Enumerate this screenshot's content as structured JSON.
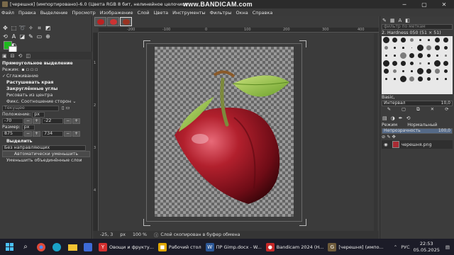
{
  "window": {
    "title": "[черешня] (импортировано)-6.0 (Цвета RGB 8 бит, нелинейное целочисленное, GIMP built-in s",
    "watermark": "www.BANDICAM.com"
  },
  "menu": [
    "Файл",
    "Правка",
    "Выделение",
    "Просмотр",
    "Изображение",
    "Слой",
    "Цвета",
    "Инструменты",
    "Фильтры",
    "Окна",
    "Справка"
  ],
  "tool_options": {
    "title": "Прямоугольное выделение",
    "mode_label": "Режим:",
    "antialias": "Сглаживание",
    "feather": "Растушевать края",
    "rounded": "Закруглённые углы",
    "from_center": "Рисовать из центра",
    "fixed_label": "Фикс. Соотношение сторон",
    "fixed_value": "Текущее",
    "position_label": "Положение:",
    "position_unit": "px",
    "pos_x": "-70",
    "pos_y": "-22",
    "size_label": "Размер:",
    "size_unit": "px",
    "size_w": "875",
    "size_h": "734",
    "highlight": "Выделить",
    "guides": "Без направляющих",
    "auto_shrink": "Автоматически уменьшить",
    "shrink_merged": "Уменьшить объединённые слои"
  },
  "status": {
    "coords": "-25, 3",
    "unit": "px",
    "zoom": "100 %",
    "message": "Слой скопирован в буфер обмена"
  },
  "brushes": {
    "filter_placeholder": "фильтр по меткам",
    "current": "2. Hardness 050 (51 × 51)",
    "preset": "Basic,",
    "spacing_label": "Интервал",
    "spacing_value": "10,0"
  },
  "layers": {
    "mode_label": "Режим",
    "mode_value": "Нормальный",
    "opacity_label": "Непрозрачность",
    "opacity_value": "100,0",
    "layer_name": "черешня.png"
  },
  "taskbar": {
    "items": [
      {
        "label": "Овощи и фрукту...",
        "color": "#d32f2f",
        "glyph": "Y"
      },
      {
        "label": "Рабочий стол",
        "color": "#e0a800",
        "glyph": "■"
      },
      {
        "label": "ПР Gimp.docx - W...",
        "color": "#2b5797",
        "glyph": "W"
      },
      {
        "label": "Bandicam 2024 (H...",
        "color": "#c62828",
        "glyph": "●"
      },
      {
        "label": "[черешня] (импо...",
        "color": "#6d5a3a",
        "glyph": "G"
      }
    ],
    "lang": "РУС",
    "time": "22:53",
    "date": "05.05.2025"
  },
  "colors": {
    "fg": "#1fb81f",
    "bg": "#ffffff",
    "cherry": "#a51d2a"
  }
}
